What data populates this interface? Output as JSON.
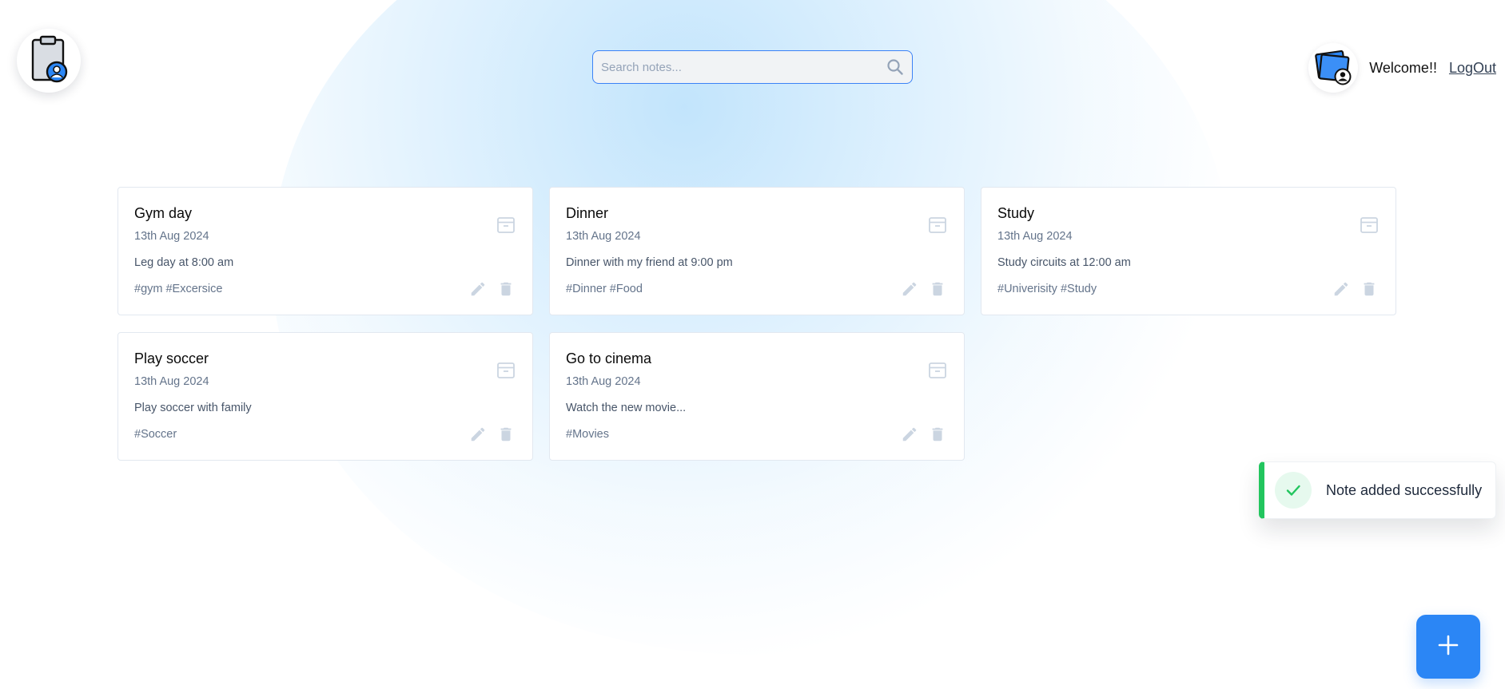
{
  "header": {
    "logo_icon": "clipboard-user-icon",
    "search": {
      "placeholder": "Search notes...",
      "value": "",
      "icon": "search-icon"
    },
    "user": {
      "avatar_icon": "user-notes-avatar-icon",
      "welcome": "Welcome!!",
      "logout": "LogOut"
    }
  },
  "notes": [
    {
      "title": "Gym day",
      "date": "13th Aug 2024",
      "content": "Leg day at 8:00 am",
      "tags": "#gym #Excersice"
    },
    {
      "title": "Dinner",
      "date": "13th Aug 2024",
      "content": "Dinner with my friend at 9:00 pm",
      "tags": "#Dinner #Food"
    },
    {
      "title": "Study",
      "date": "13th Aug 2024",
      "content": "Study circuits at 12:00 am",
      "tags": "#Univerisity #Study"
    },
    {
      "title": "Play soccer",
      "date": "13th Aug 2024",
      "content": "Play soccer with family",
      "tags": "#Soccer"
    },
    {
      "title": "Go to cinema",
      "date": "13th Aug 2024",
      "content": "Watch the new movie...",
      "tags": "#Movies"
    }
  ],
  "toast": {
    "message": "Note added successfully",
    "icon": "check-icon",
    "accent": "#22c55e"
  },
  "fab": {
    "label": "+",
    "icon": "plus-icon",
    "color": "#2b86f5"
  },
  "colors": {
    "search_border": "#3b82f6",
    "icon_gray": "#cbd5e1"
  }
}
